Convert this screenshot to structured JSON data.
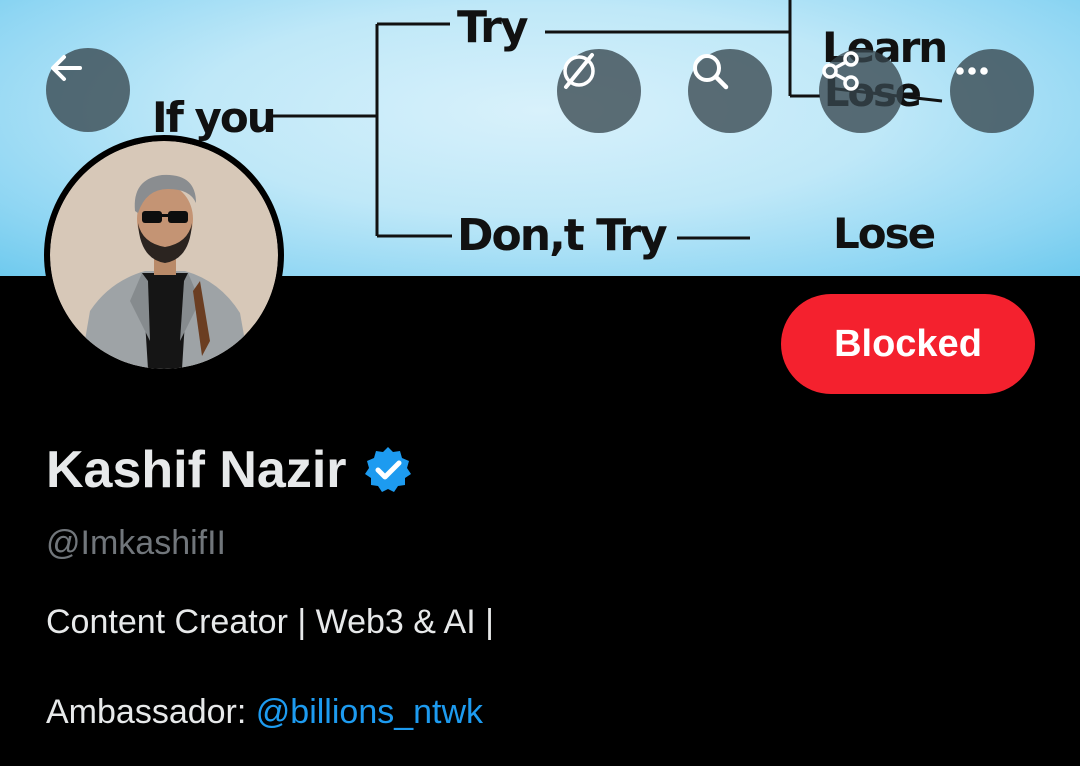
{
  "banner": {
    "words": {
      "if_you": "If you",
      "try": "Try",
      "dont_try": "Don,t Try",
      "learn": "Learn",
      "lose_top": "Lose",
      "lose_bottom": "Lose"
    }
  },
  "header_buttons": {
    "back_icon": "arrow-left-icon",
    "grok_icon": "grok-icon",
    "search_icon": "search-icon",
    "share_icon": "share-icon",
    "more_icon": "more-dots-icon"
  },
  "profile": {
    "name": "Kashif Nazir",
    "handle": "@ImkashifII",
    "bio_line1": "Content Creator | Web3 & AI |",
    "bio_line2_prefix": "Ambassador: ",
    "bio_line2_mention": "@billions_ntwk",
    "blocked_label": "Blocked"
  },
  "colors": {
    "blocked": "#f4212e",
    "verified": "#1d9bf0",
    "mention": "#1d9bf0",
    "handle": "#71767b"
  }
}
